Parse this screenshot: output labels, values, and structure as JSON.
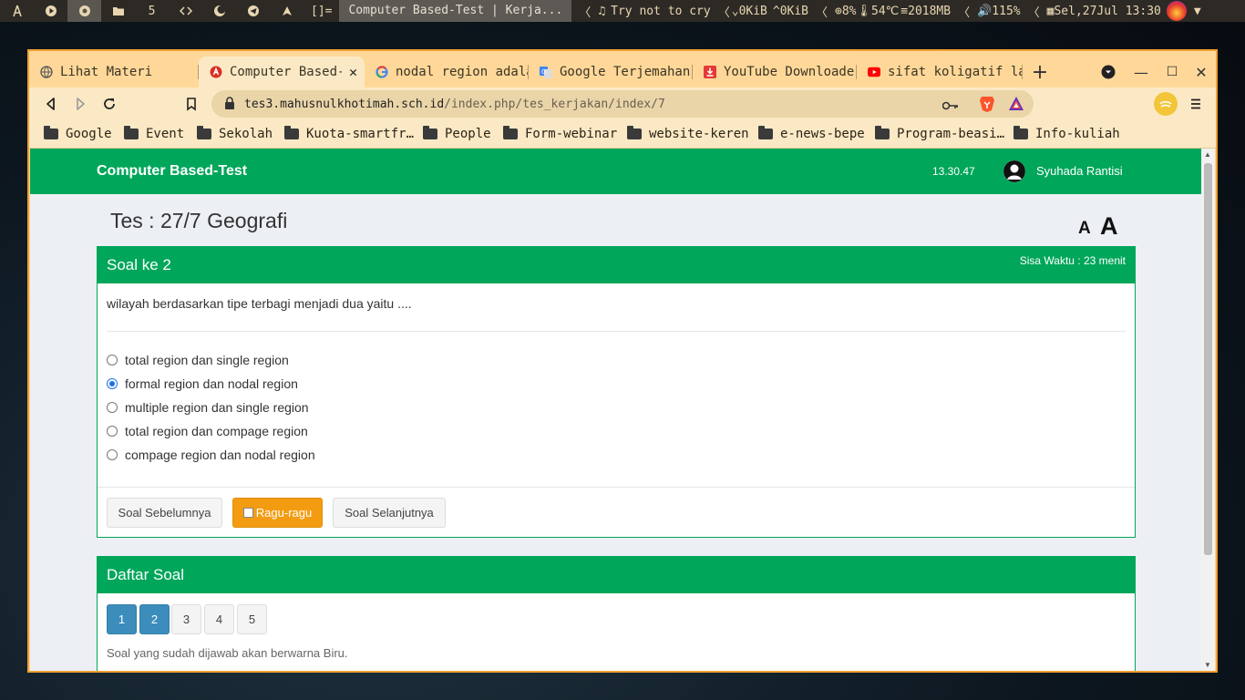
{
  "sysbar": {
    "workspace_num": "5",
    "layout": "[]=",
    "window_title": "Computer Based-Test | Kerja...",
    "music": "Try not to cry",
    "net_down": "0KiB",
    "net_up": "0KiB",
    "cpu": "8%",
    "temp": "54℃",
    "mem": "2018MB",
    "volume": "115%",
    "datetime": "Sel,27Jul 13:30"
  },
  "tabs": [
    {
      "label": "Lihat Materi",
      "icon": "globe-icon",
      "active": false
    },
    {
      "label": "Computer Based-Test | Kerjakan",
      "icon": "app-red-icon",
      "active": true
    },
    {
      "label": "nodal region adalah",
      "icon": "google-icon",
      "active": false
    },
    {
      "label": "Google Terjemahan",
      "icon": "google-translate-icon",
      "active": false
    },
    {
      "label": "YouTube Downloader",
      "icon": "download-red-icon",
      "active": false
    },
    {
      "label": "sifat koligatif larutan",
      "icon": "youtube-icon",
      "active": false
    }
  ],
  "address": {
    "host": "tes3.mahusnulkhotimah.sch.id",
    "path": "/index.php/tes_kerjakan/index/7"
  },
  "bookmarks": [
    "Google",
    "Event",
    "Sekolah",
    "Kuota-smartfr…",
    "People",
    "Form-webinar",
    "website-keren",
    "e-news-bepe",
    "Program-beasi…",
    "Info-kuliah"
  ],
  "page": {
    "brand": "Computer Based-Test",
    "clock": "13.30.47",
    "user": "Syuhada Rantisi",
    "title": "Tes : 27/7 Geografi",
    "font_small": "A",
    "font_large": "A",
    "question_box": {
      "heading": "Soal ke 2",
      "timer": "Sisa Waktu : 23 menit",
      "question": "wilayah berdasarkan tipe terbagi menjadi dua yaitu ....",
      "options": [
        {
          "text": "total region dan single region",
          "checked": false
        },
        {
          "text": "formal region dan nodal region",
          "checked": true
        },
        {
          "text": "multiple region dan single region",
          "checked": false
        },
        {
          "text": "total region dan compage region",
          "checked": false
        },
        {
          "text": "compage region dan nodal region",
          "checked": false
        }
      ],
      "prev_label": "Soal Sebelumnya",
      "doubt_label": "Ragu-ragu",
      "next_label": "Soal Selanjutnya"
    },
    "list_box": {
      "heading": "Daftar Soal",
      "numbers": [
        {
          "n": "1",
          "answered": true
        },
        {
          "n": "2",
          "answered": true
        },
        {
          "n": "3",
          "answered": false
        },
        {
          "n": "4",
          "answered": false
        },
        {
          "n": "5",
          "answered": false
        }
      ],
      "note": "Soal yang sudah dijawab akan berwarna Biru."
    }
  },
  "colors": {
    "brand_green": "#00a65a",
    "answered_blue": "#3c8dbc",
    "warning_orange": "#f39c12",
    "browser_theme": "#fbe9c5"
  }
}
